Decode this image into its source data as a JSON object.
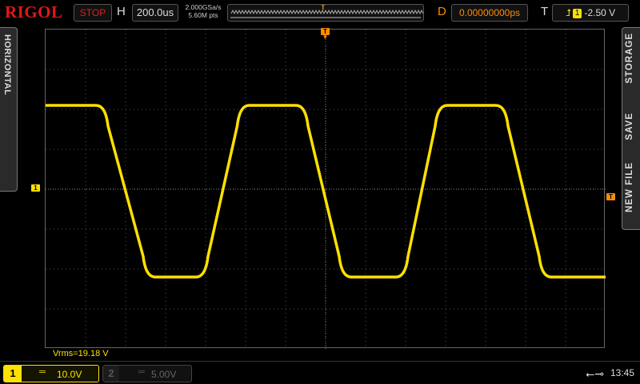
{
  "brand": "RIGOL",
  "top_bar": {
    "run_state": "STOP",
    "horizontal_label": "H",
    "timebase": "200.0us",
    "sample_rate": "2.000GSa/s",
    "memory_depth": "5.60M pts",
    "trigger_position_marker": "T",
    "delay_label": "D",
    "delay_value": "0.00000000ps",
    "trigger_label": "T",
    "trigger_edge_icon": "rising-edge-icon",
    "trigger_source": "1",
    "trigger_level": "-2.50 V"
  },
  "left_tab": {
    "label": "HORIZONTAL"
  },
  "right_tab": {
    "items": [
      "STORAGE",
      "SAVE",
      "NEW FILE"
    ]
  },
  "markers": {
    "ch1_ground": "1",
    "trigger_top": "T",
    "trigger_level": "T"
  },
  "measurement": "Vrms=19.18 V",
  "channels": [
    {
      "number": "1",
      "coupling": "═",
      "scale": "10.0V",
      "color": "#ffe000",
      "active": true
    },
    {
      "number": "2",
      "coupling": "═",
      "scale": "5.00V",
      "color": "#555555",
      "active": false
    }
  ],
  "status": {
    "usb_icon": "usb-icon",
    "time": "13:45"
  },
  "waveform": {
    "color": "#ffe000",
    "shape": "trapezoidal square wave",
    "levels_divisions": {
      "high": 2.1,
      "low": -2.2
    },
    "transitions": [
      {
        "start_div": 1.5,
        "end_div": 2.5,
        "direction": "fall"
      },
      {
        "start_div": 4.0,
        "end_div": 4.85,
        "direction": "rise"
      },
      {
        "start_div": 6.5,
        "end_div": 7.4,
        "direction": "fall"
      },
      {
        "start_div": 9.0,
        "end_div": 9.8,
        "direction": "rise"
      },
      {
        "start_div": 11.5,
        "end_div": 12.4,
        "direction": "fall"
      }
    ]
  }
}
